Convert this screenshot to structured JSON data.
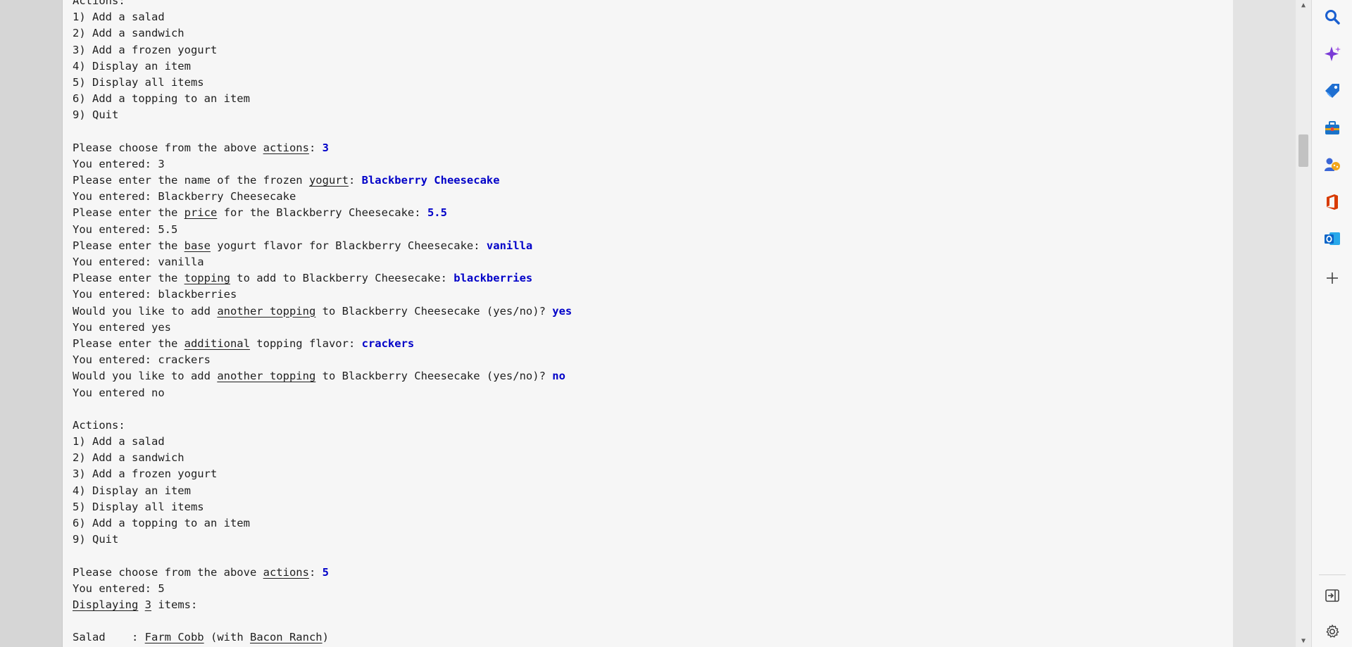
{
  "console": {
    "lines": [
      [
        {
          "t": "Actions:"
        }
      ],
      [
        {
          "t": "1) Add a salad"
        }
      ],
      [
        {
          "t": "2) Add a sandwich"
        }
      ],
      [
        {
          "t": "3) Add a frozen yogurt"
        }
      ],
      [
        {
          "t": "4) Display an item"
        }
      ],
      [
        {
          "t": "5) Display all items"
        }
      ],
      [
        {
          "t": "6) Add a topping to an item"
        }
      ],
      [
        {
          "t": "9) Quit"
        }
      ],
      [],
      [
        {
          "t": "Please choose from the above "
        },
        {
          "t": "actions",
          "u": true
        },
        {
          "t": ": "
        },
        {
          "t": "3",
          "in": true
        }
      ],
      [
        {
          "t": "You entered: 3"
        }
      ],
      [
        {
          "t": "Please enter the name of the frozen "
        },
        {
          "t": "yogurt",
          "u": true
        },
        {
          "t": ": "
        },
        {
          "t": "Blackberry Cheesecake",
          "in": true
        }
      ],
      [
        {
          "t": "You entered: Blackberry Cheesecake"
        }
      ],
      [
        {
          "t": "Please enter the "
        },
        {
          "t": "price",
          "u": true
        },
        {
          "t": " for the Blackberry Cheesecake: "
        },
        {
          "t": "5.5",
          "in": true
        }
      ],
      [
        {
          "t": "You entered: 5.5"
        }
      ],
      [
        {
          "t": "Please enter the "
        },
        {
          "t": "base",
          "u": true
        },
        {
          "t": " yogurt flavor for Blackberry Cheesecake: "
        },
        {
          "t": "vanilla",
          "in": true
        }
      ],
      [
        {
          "t": "You entered: vanilla"
        }
      ],
      [
        {
          "t": "Please enter the "
        },
        {
          "t": "topping",
          "u": true
        },
        {
          "t": " to add to Blackberry Cheesecake: "
        },
        {
          "t": "blackberries",
          "in": true
        }
      ],
      [
        {
          "t": "You entered: blackberries"
        }
      ],
      [
        {
          "t": "Would you like to add "
        },
        {
          "t": "another topping",
          "u": true
        },
        {
          "t": " to Blackberry Cheesecake (yes/no)? "
        },
        {
          "t": "yes",
          "in": true
        }
      ],
      [
        {
          "t": "You entered yes"
        }
      ],
      [
        {
          "t": "Please enter the "
        },
        {
          "t": "additional",
          "u": true
        },
        {
          "t": " topping flavor: "
        },
        {
          "t": "crackers",
          "in": true
        }
      ],
      [
        {
          "t": "You entered: crackers"
        }
      ],
      [
        {
          "t": "Would you like to add "
        },
        {
          "t": "another topping",
          "u": true
        },
        {
          "t": " to Blackberry Cheesecake (yes/no)? "
        },
        {
          "t": "no",
          "in": true
        }
      ],
      [
        {
          "t": "You entered no"
        }
      ],
      [],
      [
        {
          "t": "Actions:"
        }
      ],
      [
        {
          "t": "1) Add a salad"
        }
      ],
      [
        {
          "t": "2) Add a sandwich"
        }
      ],
      [
        {
          "t": "3) Add a frozen yogurt"
        }
      ],
      [
        {
          "t": "4) Display an item"
        }
      ],
      [
        {
          "t": "5) Display all items"
        }
      ],
      [
        {
          "t": "6) Add a topping to an item"
        }
      ],
      [
        {
          "t": "9) Quit"
        }
      ],
      [],
      [
        {
          "t": "Please choose from the above "
        },
        {
          "t": "actions",
          "u": true
        },
        {
          "t": ": "
        },
        {
          "t": "5",
          "in": true
        }
      ],
      [
        {
          "t": "You entered: 5"
        }
      ],
      [
        {
          "t": "Displaying",
          "u": true
        },
        {
          "t": " "
        },
        {
          "t": "3",
          "u": true
        },
        {
          "t": " items:"
        }
      ],
      [],
      [
        {
          "t": "Salad    : "
        },
        {
          "t": "Farm Cobb",
          "u": true
        },
        {
          "t": " (with "
        },
        {
          "t": "Bacon Ranch",
          "u": true
        },
        {
          "t": ")"
        }
      ]
    ]
  },
  "sidebar": {
    "items": [
      {
        "icon": "search-icon",
        "color": "#1a5fd0"
      },
      {
        "icon": "copilot-sparkle-icon",
        "color": "#7a3bd6"
      },
      {
        "icon": "shopping-tag-icon",
        "color": "#1f6fd1"
      },
      {
        "icon": "tools-briefcase-icon",
        "color": "#1a73c9"
      },
      {
        "icon": "games-icon",
        "color": "#3b66d6"
      },
      {
        "icon": "office-icon",
        "color": "#d83b01"
      },
      {
        "icon": "outlook-icon",
        "color": "#0a64c8"
      },
      {
        "icon": "add-icon",
        "color": "#444444"
      },
      {
        "icon": "hide-sidebar-icon",
        "color": "#444444"
      },
      {
        "icon": "settings-icon",
        "color": "#444444"
      }
    ]
  }
}
